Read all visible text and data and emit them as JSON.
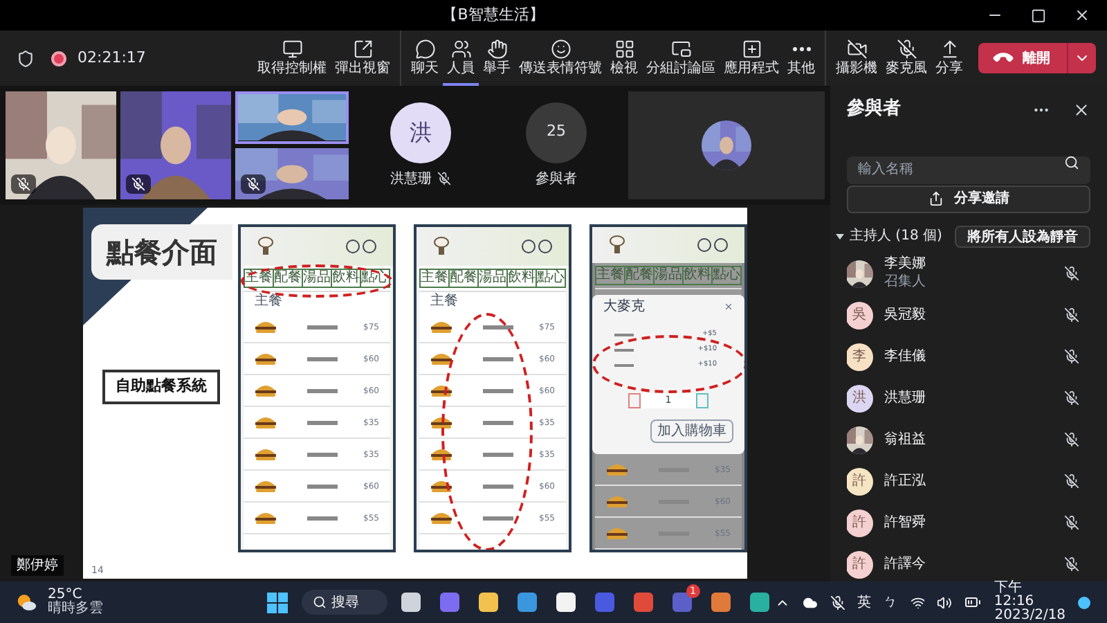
{
  "window": {
    "title": "【B智慧生活】"
  },
  "meeting": {
    "timer": "02:21:17",
    "recording": true
  },
  "toolbar": {
    "groups": [
      [
        {
          "label": "取得控制權",
          "selected": false
        },
        {
          "label": "彈出視窗",
          "selected": false
        }
      ],
      [
        {
          "label": "聊天",
          "selected": false
        },
        {
          "label": "人員",
          "selected": true
        },
        {
          "label": "舉手",
          "selected": false
        },
        {
          "label": "傳送表情符號",
          "selected": false
        },
        {
          "label": "檢視",
          "selected": false
        },
        {
          "label": "分組討論區",
          "selected": false
        },
        {
          "label": "應用程式",
          "selected": false
        },
        {
          "label": "其他",
          "selected": false
        }
      ],
      [
        {
          "label": "攝影機",
          "selected": false
        },
        {
          "label": "麥克風",
          "selected": false
        },
        {
          "label": "分享",
          "selected": false
        }
      ]
    ],
    "leave_button": {
      "label": "離開"
    }
  },
  "video_tiles": [
    {
      "muted": true
    },
    {
      "muted": true
    }
  ],
  "stacked_tiles": [
    {
      "muted": false,
      "speaking": true
    },
    {
      "muted": true,
      "speaking": false
    }
  ],
  "avatar_tiles": [
    {
      "kind": "person",
      "initial": "洪",
      "name": "洪慧珊",
      "muted": true
    },
    {
      "kind": "count",
      "initial": "25",
      "name": "參與者"
    }
  ],
  "presenter_label": "鄭伊婷",
  "slide": {
    "title": "點餐介面",
    "subtitle": "自助點餐系統",
    "page": "14",
    "phones": [
      {
        "kind": "tabs",
        "tabs": [
          "主餐",
          "配餐",
          "湯品",
          "飲料",
          "點心"
        ],
        "section": "主餐",
        "prices": [
          "$75",
          "$60",
          "$60",
          "$35",
          "$35",
          "$60",
          "$55"
        ]
      },
      {
        "kind": "items",
        "tabs": [
          "主餐",
          "配餐",
          "湯品",
          "飲料",
          "點心"
        ],
        "section": "主餐",
        "prices": [
          "$75",
          "$60",
          "$60",
          "$35",
          "$35",
          "$60",
          "$55"
        ]
      },
      {
        "kind": "options",
        "tabs": [
          "主餐",
          "配餐",
          "湯品",
          "飲料",
          "點心"
        ],
        "prices": [
          "$35",
          "$60",
          "$55"
        ],
        "dialog": {
          "title": "大麥克",
          "options": [
            "+$5",
            "+$10",
            "+$10"
          ],
          "quantity": "1",
          "button": "加入購物車"
        }
      }
    ]
  },
  "participants": {
    "title": "參與者",
    "search": {
      "placeholder": "輸入名稱"
    },
    "share_button": "分享邀請",
    "section": {
      "label": "主持人 (18 個)",
      "expanded": true,
      "mute_all": "將所有人設為靜音"
    },
    "people": [
      {
        "name": "李美娜",
        "status": "召集人",
        "muted": true
      },
      {
        "name": "吳冠毅",
        "kind": "initial",
        "initial": "吳",
        "color": "#f5d0d0",
        "muted": true
      },
      {
        "name": "李佳儀",
        "kind": "initial",
        "initial": "李",
        "color": "#f7e0c4",
        "muted": true
      },
      {
        "name": "洪慧珊",
        "kind": "initial",
        "initial": "洪",
        "color": "#dcd6f3",
        "muted": true
      },
      {
        "name": "翁祖益",
        "muted": true
      },
      {
        "name": "許正泓",
        "kind": "initial",
        "initial": "許",
        "color": "#f5e5c3",
        "muted": true
      },
      {
        "name": "許智舜",
        "kind": "initial",
        "initial": "許",
        "color": "#f5d0d0",
        "muted": true
      },
      {
        "name": "許譯今",
        "kind": "initial",
        "initial": "許",
        "color": "#f5d0d0",
        "muted": true
      }
    ]
  },
  "taskbar": {
    "weather": {
      "temp": "25°C",
      "desc": "晴時多雲"
    },
    "search": "搜尋",
    "apps": [
      {
        "kind": "taskview"
      },
      {
        "kind": "meet"
      },
      {
        "kind": "folder"
      },
      {
        "kind": "mail"
      },
      {
        "kind": "store"
      },
      {
        "kind": "editor"
      },
      {
        "kind": "chrome"
      },
      {
        "kind": "teams",
        "badge": "1"
      },
      {
        "kind": "player"
      },
      {
        "kind": "edge"
      }
    ],
    "ime": "英",
    "ime_mode": "ㄅ",
    "time": "下午 12:16",
    "date": "2023/2/18"
  }
}
